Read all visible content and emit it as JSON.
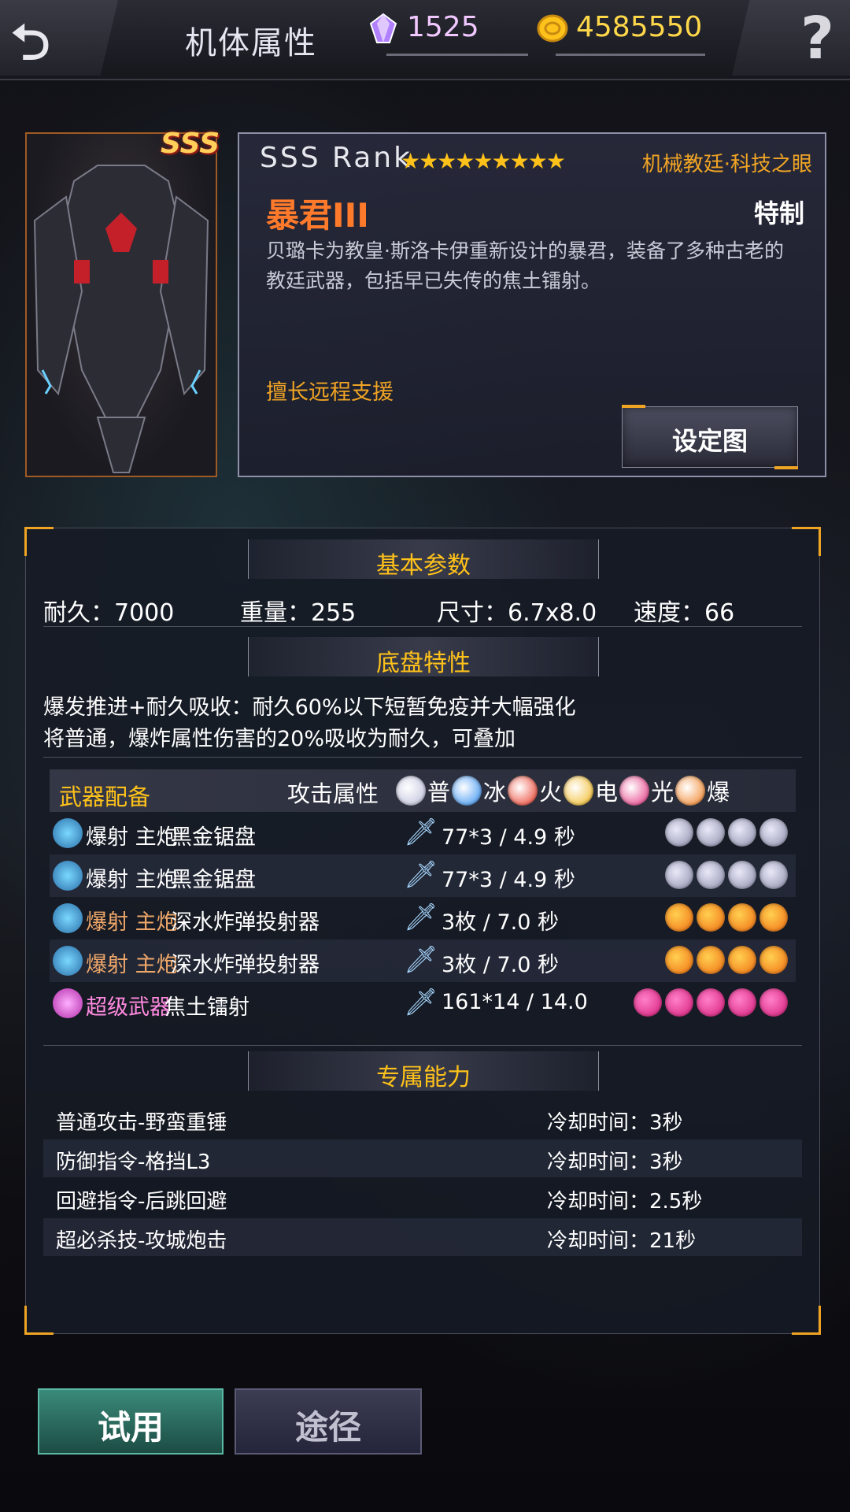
{
  "header": {
    "title": "机体属性",
    "gems": "1525",
    "coins": "4585550",
    "back_icon": "back-arrow-icon",
    "help_icon": "question-icon"
  },
  "unit": {
    "rank_badge": "SSS",
    "rank_text": "SSS Rank",
    "stars": "★★★★★★★★★",
    "faction": "机械教廷·科技之眼",
    "name": "暴君III",
    "type": "特制",
    "description": "贝璐卡为教皇·斯洛卡伊重新设计的暴君，装备了多种古老的教廷武器，包括早已失传的焦土镭射。",
    "specialty": "擅长远程支援",
    "setting_button": "设定图"
  },
  "basic": {
    "heading": "基本参数",
    "durability": "耐久：7000",
    "weight": "重量：255",
    "size": "尺寸：6.7x8.0",
    "speed": "速度：66"
  },
  "chassis": {
    "heading": "底盘特性",
    "line1": "爆发推进+耐久吸收：耐久60%以下短暂免疫并大幅强化",
    "line2": "将普通，爆炸属性伤害的20%吸收为耐久，可叠加"
  },
  "weapons": {
    "heading": "武器配备",
    "attack_label": "攻击属性",
    "elements": [
      {
        "label": "普",
        "color": "#b8bad8",
        "icon": "normal-element-icon"
      },
      {
        "label": "冰",
        "color": "#2a8af0",
        "icon": "ice-element-icon"
      },
      {
        "label": "火",
        "color": "#e8301c",
        "icon": "fire-element-icon"
      },
      {
        "label": "电",
        "color": "#f0b414",
        "icon": "electric-element-icon"
      },
      {
        "label": "光",
        "color": "#e4287a",
        "icon": "light-element-icon"
      },
      {
        "label": "爆",
        "color": "#f07814",
        "icon": "explode-element-icon"
      }
    ],
    "rows": [
      {
        "type": "爆射 主炮",
        "type_color": "#ffffff",
        "name": "黑金锯盘",
        "stat": "77*3 / 4.9 秒",
        "orb": "normal",
        "orbs": 4
      },
      {
        "type": "爆射 主炮",
        "type_color": "#ffffff",
        "name": "黑金锯盘",
        "stat": "77*3 / 4.9 秒",
        "orb": "normal",
        "orbs": 4
      },
      {
        "type": "爆射 主炮",
        "type_color": "#f0a86a",
        "name": "深水炸弹投射器",
        "stat": "3枚 / 7.0 秒",
        "orb": "explode",
        "orbs": 4
      },
      {
        "type": "爆射 主炮",
        "type_color": "#f0a86a",
        "name": "深水炸弹投射器",
        "stat": "3枚 / 7.0 秒",
        "orb": "explode",
        "orbs": 4
      },
      {
        "type": "超级武器",
        "type_color": "#ff8ae0",
        "name": "焦土镭射",
        "stat": "161*14 / 14.0",
        "orb": "light",
        "orbs": 5
      }
    ]
  },
  "abilities": {
    "heading": "专属能力",
    "rows": [
      {
        "name": "普通攻击-野蛮重锤",
        "cooldown": "冷却时间：3秒"
      },
      {
        "name": "防御指令-格挡L3",
        "cooldown": "冷却时间：3秒"
      },
      {
        "name": "回避指令-后跳回避",
        "cooldown": "冷却时间：2.5秒"
      },
      {
        "name": "超必杀技-攻城炮击",
        "cooldown": "冷却时间：21秒"
      }
    ]
  },
  "buttons": {
    "try": "试用",
    "path": "途径"
  }
}
